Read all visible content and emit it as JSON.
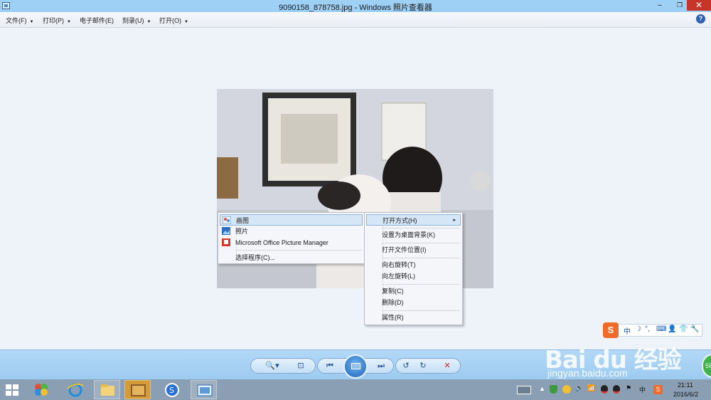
{
  "window": {
    "title": "9090158_878758.jpg - Windows 照片查看器",
    "minimize": "–",
    "restore": "❐",
    "close": "✕"
  },
  "menubar": {
    "items": [
      {
        "label": "文件(F)"
      },
      {
        "label": "打印(P)"
      },
      {
        "label": "电子邮件(E)"
      },
      {
        "label": "刻录(U)"
      },
      {
        "label": "打开(O)"
      }
    ],
    "dropdown_glyph": "▼",
    "help": "?"
  },
  "context_menu": {
    "items": [
      {
        "label": "打开方式(H)",
        "highlighted": true,
        "has_submenu": true
      },
      {
        "label": "设置为桌面背景(K)"
      },
      {
        "label": "打开文件位置(I)"
      },
      {
        "label": "向右旋转(T)"
      },
      {
        "label": "向左旋转(L)"
      },
      {
        "label": "复制(C)"
      },
      {
        "label": "删除(D)"
      },
      {
        "label": "属性(R)"
      }
    ],
    "submenu_glyph": "▸"
  },
  "open_with_submenu": {
    "items": [
      {
        "label": "画图",
        "icon": "paint-icon",
        "highlighted": true
      },
      {
        "label": "照片",
        "icon": "photos-icon"
      },
      {
        "label": "Microsoft Office Picture Manager",
        "icon": "picture-manager-icon"
      },
      {
        "label": "选择程序(C)..."
      }
    ]
  },
  "navbar": {
    "zoom": "🔍▾",
    "actual_size": "⊡",
    "previous": "⏮",
    "next": "⏭",
    "rotate_ccw": "↺",
    "rotate_cw": "↻",
    "delete": "✕"
  },
  "ime_toolbar": {
    "logo": "S",
    "mode": "中",
    "moon": "☽",
    "punct": "°,",
    "keyboard": "⌨",
    "user": "👤",
    "shirt": "👕",
    "wrench": "🔧"
  },
  "taskbar": {
    "time": "21:11",
    "date": "2016/6/2",
    "ime": "中"
  },
  "watermark": {
    "logo": "Bai du 经验",
    "url": "jingyan.baidu.com"
  },
  "badge": "58"
}
